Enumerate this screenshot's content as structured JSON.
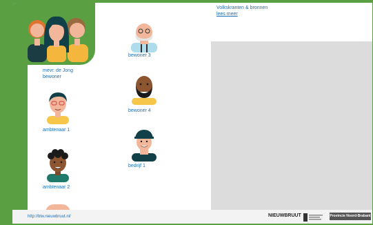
{
  "info": {
    "line1": "Volkskranten & bronnen",
    "link": "lees meer"
  },
  "people": [
    {
      "label_line1": "mevr. de Jong",
      "label_line2": "bewoner"
    },
    {
      "label_line1": "ambtenaar 1"
    },
    {
      "label_line1": "ambtenaar 2"
    },
    {
      "label_line1": "bewoner 3"
    },
    {
      "label_line1": "bewoner 4"
    },
    {
      "label_line1": "bedrijf 1"
    }
  ],
  "footer": {
    "url": "http://blw.nieuwbruut.nl/",
    "brand": "NIEUWBRUUT",
    "province": "Provincie Noord-Brabant"
  },
  "colors": {
    "accent": "#5aa043",
    "link": "#1a6fb8"
  }
}
